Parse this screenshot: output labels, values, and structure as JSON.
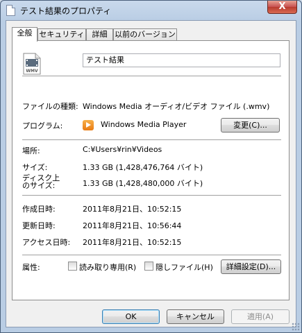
{
  "window": {
    "title": "テスト結果のプロパティ",
    "close_glyph": "X"
  },
  "tabs": [
    {
      "label": "全般",
      "active": true
    },
    {
      "label": "セキュリティ",
      "active": false
    },
    {
      "label": "詳細",
      "active": false
    },
    {
      "label": "以前のバージョン",
      "active": false
    }
  ],
  "general": {
    "file_icon_text": "WMV",
    "file_name": "テスト結果",
    "file_type_label": "ファイルの種類:",
    "file_type_value": "Windows Media オーディオ/ビデオ ファイル (.wmv)",
    "program_label": "プログラム:",
    "program_value": "Windows Media Player",
    "change_button": "変更(C)...",
    "location_label": "場所:",
    "location_value": "C:¥Users¥rin¥Videos",
    "size_label": "サイズ:",
    "size_value": "1.33 GB (1,428,476,764 バイト)",
    "disk_size_label_line1": "ディスク上",
    "disk_size_label_line2": "のサイズ:",
    "disk_size_value": "1.33 GB (1,428,480,000 バイト)",
    "created_label": "作成日時:",
    "created_value": "2011年8月21日、10:52:15",
    "modified_label": "更新日時:",
    "modified_value": "2011年8月21日、10:56:44",
    "accessed_label": "アクセス日時:",
    "accessed_value": "2011年8月21日、10:52:15",
    "attributes_label": "属性:",
    "readonly_label": "読み取り専用(R)",
    "readonly_checked": false,
    "hidden_label": "隠しファイル(H)",
    "hidden_checked": false,
    "advanced_button": "詳細設定(D)..."
  },
  "footer": {
    "ok": "OK",
    "cancel": "キャンセル",
    "apply": "適用(A)"
  }
}
